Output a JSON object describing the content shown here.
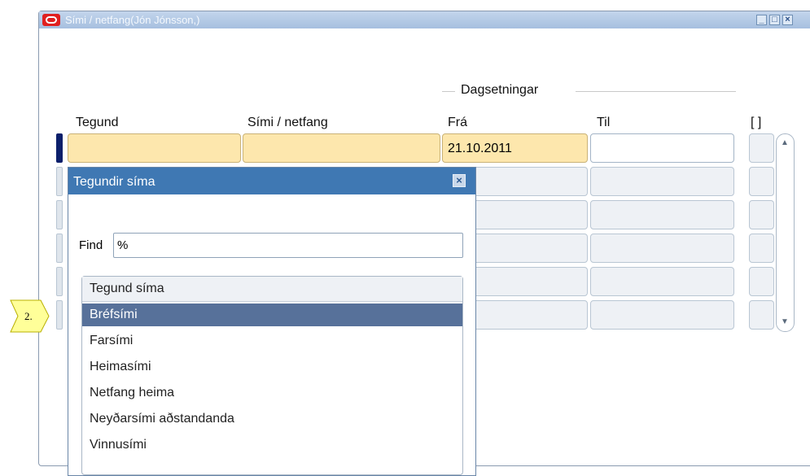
{
  "window": {
    "title": "Sími / netfang(Jón Jónsson,)",
    "controls": {
      "minimize": "_",
      "maximize": "□",
      "close": "×"
    }
  },
  "form": {
    "group_label": "Dagsetningar",
    "columns": {
      "tegund": "Tegund",
      "simi_netfang": "Sími / netfang",
      "fra": "Frá",
      "til": "Til",
      "flag": "[ ]"
    },
    "rows": [
      {
        "tegund": "",
        "simi_netfang": "",
        "fra": "21.10.2011",
        "til": ""
      },
      {
        "tegund": "",
        "simi_netfang": "",
        "fra": "",
        "til": ""
      },
      {
        "tegund": "",
        "simi_netfang": "",
        "fra": "",
        "til": ""
      },
      {
        "tegund": "",
        "simi_netfang": "",
        "fra": "",
        "til": ""
      },
      {
        "tegund": "",
        "simi_netfang": "",
        "fra": "",
        "til": ""
      },
      {
        "tegund": "",
        "simi_netfang": "",
        "fra": "",
        "til": ""
      }
    ]
  },
  "callout": {
    "label": "2."
  },
  "popup": {
    "title": "Tegundir síma",
    "find_label": "Find",
    "find_value": "%",
    "list_header": "Tegund síma",
    "items": [
      {
        "label": "Bréfsími",
        "selected": true
      },
      {
        "label": "Farsími",
        "selected": false
      },
      {
        "label": "Heimasími",
        "selected": false
      },
      {
        "label": "Netfang heima",
        "selected": false
      },
      {
        "label": "Neyðarsími aðstandanda",
        "selected": false
      },
      {
        "label": "Vinnusími",
        "selected": false
      }
    ]
  },
  "colors": {
    "active_field": "#fde7ad",
    "selected_row": "#57719a",
    "popup_titlebar": "#3f78b3",
    "callout_fill": "#ffff99"
  }
}
